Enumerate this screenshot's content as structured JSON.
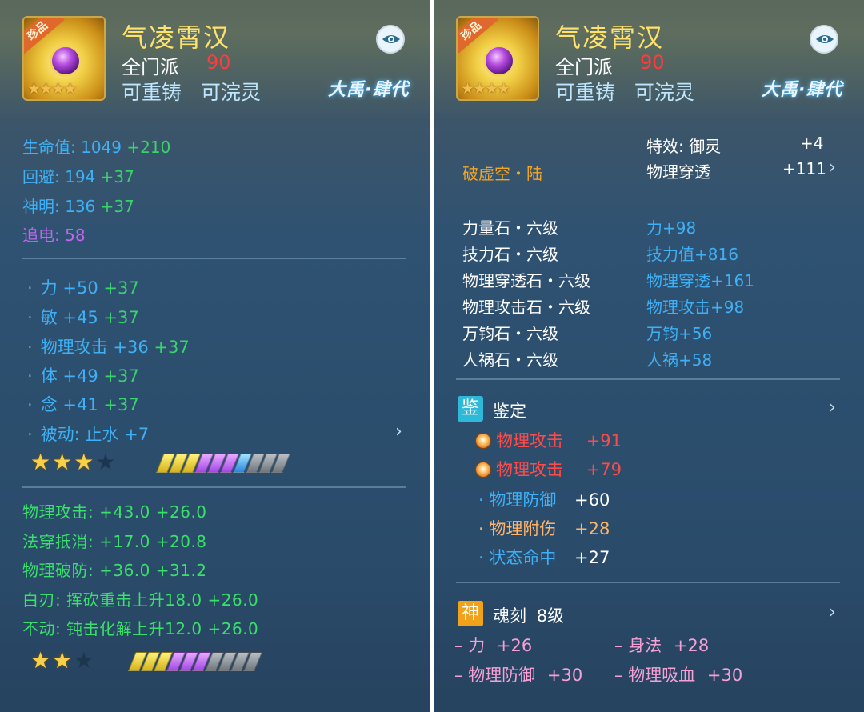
{
  "panels": [
    {
      "item_name": "气凌霄汉",
      "icon_tag": "珍品",
      "sect": "全门派",
      "level": "90",
      "recast": "可重铸",
      "wash": "可浣灵",
      "brand": "大禹·肆代",
      "base_stats": [
        {
          "label": "生命值:",
          "value": "1049",
          "bonus": "+210"
        },
        {
          "label": "回避:",
          "value": "194",
          "bonus": "+37"
        },
        {
          "label": "神明:",
          "value": "136",
          "bonus": "+37"
        },
        {
          "label": "追电:",
          "value": "58",
          "bonus": ""
        }
      ],
      "attributes": [
        {
          "label": "力",
          "value": "+50",
          "bonus": "+37"
        },
        {
          "label": "敏",
          "value": "+45",
          "bonus": "+37"
        },
        {
          "label": "物理攻击",
          "value": "+36",
          "bonus": "+37"
        },
        {
          "label": "体",
          "value": "+49",
          "bonus": "+37"
        },
        {
          "label": "念",
          "value": "+41",
          "bonus": "+37"
        },
        {
          "label": "被动: 止水",
          "value": "+7",
          "bonus": ""
        }
      ],
      "stars_a": {
        "filled": 3,
        "total": 4
      },
      "gems_a": [
        "y",
        "y",
        "y",
        "p",
        "p",
        "p",
        "b",
        "g",
        "g",
        "g"
      ],
      "green_stats": [
        "物理攻击: +43.0 +26.0",
        "法穿抵消: +17.0 +20.8",
        "物理破防: +36.0 +31.2",
        "白刃: 挥砍重击上升18.0 +26.0",
        "不动: 钝击化解上升12.0 +26.0"
      ],
      "stars_b": {
        "filled": 2,
        "total": 3
      },
      "gems_b": [
        "y",
        "y",
        "y",
        "p",
        "p",
        "p",
        "g",
        "g",
        "g",
        "g"
      ]
    },
    {
      "item_name": "气凌霄汉",
      "icon_tag": "珍品",
      "sect": "全门派",
      "level": "90",
      "recast": "可重铸",
      "wash": "可浣灵",
      "brand": "大禹·肆代",
      "special_effect": "特效: 御灵",
      "special_value": "+4",
      "phys_pen_label": "物理穿透",
      "phys_pen_value": "+111",
      "rune": "破虚空・陆",
      "gems": [
        {
          "name": "力量石・六级",
          "effect": "力+98"
        },
        {
          "name": "技力石・六级",
          "effect": "技力值+816"
        },
        {
          "name": "物理穿透石・六级",
          "effect": "物理穿透+161"
        },
        {
          "name": "物理攻击石・六级",
          "effect": "物理攻击+98"
        },
        {
          "name": "万钧石・六级",
          "effect": "万钧+56"
        },
        {
          "name": "人祸石・六级",
          "effect": "人祸+58"
        }
      ],
      "appraise_badge": "鉴",
      "appraise_title": "鉴定",
      "appraise_items": [
        {
          "label": "物理攻击",
          "value": "+91",
          "style": "red"
        },
        {
          "label": "物理攻击",
          "value": "+79",
          "style": "red"
        },
        {
          "label": "物理防御",
          "value": "+60",
          "style": "blue"
        },
        {
          "label": "物理附伤",
          "value": "+28",
          "style": "peach"
        },
        {
          "label": "状态命中",
          "value": "+27",
          "style": "blue"
        }
      ],
      "soul_badge": "神",
      "soul_title": "魂刻",
      "soul_level": "8级",
      "soul_items": [
        {
          "label": "力",
          "value": "+26"
        },
        {
          "label": "身法",
          "value": "+28"
        },
        {
          "label": "物理防御",
          "value": "+30"
        },
        {
          "label": "物理吸血",
          "value": "+30"
        }
      ]
    }
  ],
  "colors": {
    "name": "#ffe26a",
    "level": "#ff3b3b",
    "stat_blue": "#3fb0f5",
    "stat_green": "#39d36a",
    "purple": "#c265f0",
    "orange": "#f6a623",
    "red": "#ff4a4a",
    "pink": "#f6a0d6"
  },
  "icons": {
    "eye": "eye-icon",
    "chevron": "chevron-right-icon",
    "star": "star-icon",
    "medal": "medal-icon"
  }
}
